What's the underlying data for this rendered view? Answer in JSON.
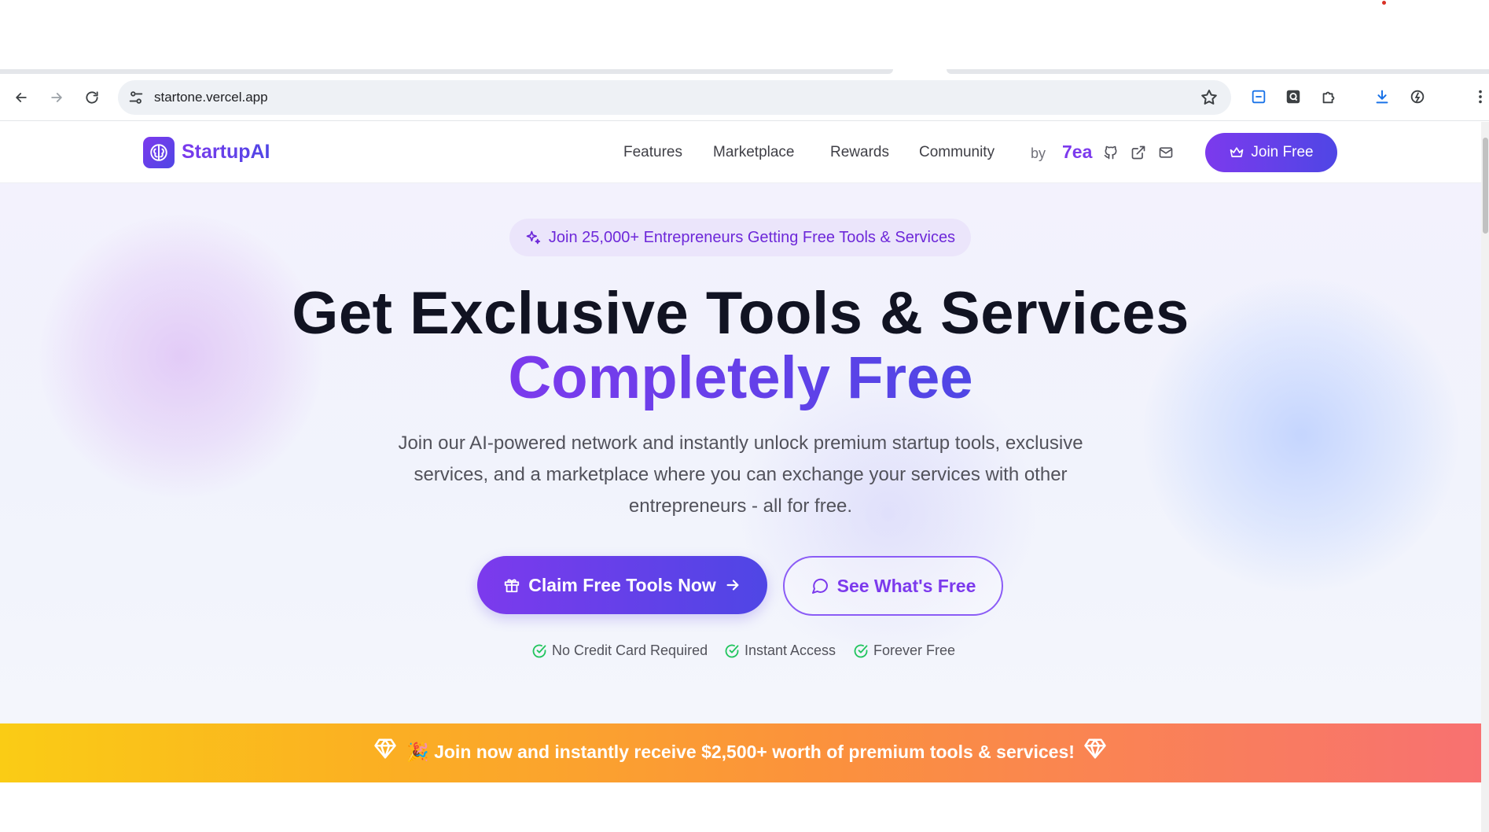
{
  "browser": {
    "url": "startone.vercel.app"
  },
  "header": {
    "logo_text": "StartupAI",
    "nav": [
      "Features",
      "Marketplace",
      "Rewards",
      "Community"
    ],
    "by_label": "by",
    "author": "7ea",
    "join_label": "Join Free"
  },
  "hero": {
    "badge": "Join 25,000+ Entrepreneurs Getting Free Tools & Services",
    "title_line1": "Get Exclusive Tools & Services",
    "title_line2": "Completely Free",
    "subtitle": "Join our AI-powered network and instantly unlock premium startup tools, exclusive services, and a marketplace where you can exchange your services with other entrepreneurs - all for free.",
    "cta_primary": "Claim Free Tools Now",
    "cta_secondary": "See What's Free",
    "perks": [
      "No Credit Card Required",
      "Instant Access",
      "Forever Free"
    ]
  },
  "promo": {
    "text": "🎉 Join now and instantly receive $2,500+ worth of premium tools & services!"
  },
  "colors": {
    "brand_purple": "#7c3aed",
    "brand_indigo": "#4f46e5",
    "perk_check": "#22c55e"
  }
}
